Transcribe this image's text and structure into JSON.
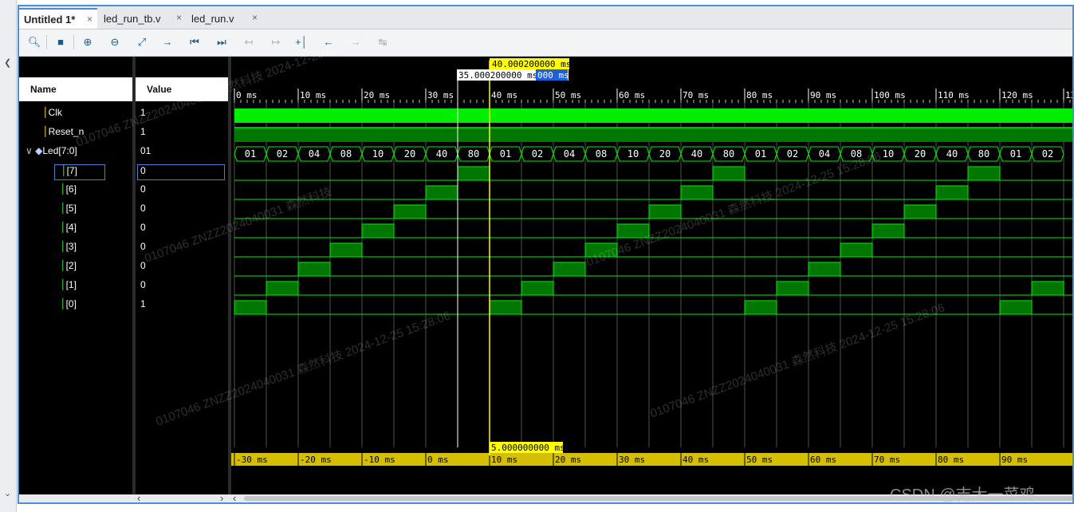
{
  "tabs": [
    {
      "label": "Untitled 1*",
      "active": true
    },
    {
      "label": "led_run_tb.v",
      "active": false
    },
    {
      "label": "led_run.v",
      "active": false
    }
  ],
  "tab_close_glyph": "×",
  "toolbar_icons": [
    "search-icon",
    "save-icon",
    "zoom-in-icon",
    "zoom-out-icon",
    "zoom-fit-icon",
    "go-to-cursor-icon",
    "go-to-time-0-icon",
    "go-to-last-time-icon",
    "previous-transition-icon",
    "next-transition-icon",
    "add-marker-icon",
    "previous-marker-icon",
    "next-marker-icon",
    "swap-cursors-icon"
  ],
  "columns": {
    "name": "Name",
    "value": "Value"
  },
  "signals": [
    {
      "name": "Clk",
      "value": "1",
      "type": "bit"
    },
    {
      "name": "Reset_n",
      "value": "1",
      "type": "bit"
    },
    {
      "name": "Led[7:0]",
      "value": "01",
      "type": "bus",
      "expanded": true
    },
    {
      "name": "[7]",
      "value": "0",
      "type": "bit",
      "selected": true
    },
    {
      "name": "[6]",
      "value": "0",
      "type": "bit"
    },
    {
      "name": "[5]",
      "value": "0",
      "type": "bit"
    },
    {
      "name": "[4]",
      "value": "0",
      "type": "bit"
    },
    {
      "name": "[3]",
      "value": "0",
      "type": "bit"
    },
    {
      "name": "[2]",
      "value": "0",
      "type": "bit"
    },
    {
      "name": "[1]",
      "value": "0",
      "type": "bit"
    },
    {
      "name": "[0]",
      "value": "1",
      "type": "bit"
    }
  ],
  "cursor": {
    "main": "40.000200000 ms",
    "secondary": "35.000200000 ms",
    "secondary_hidden": "000 ms",
    "delta": "5.000000000 ms"
  },
  "top_ruler": {
    "labels": [
      "0 ms",
      "10 ms",
      "20 ms",
      "30 ms",
      "40 ms",
      "50 ms",
      "60 ms",
      "70 ms",
      "80 ms",
      "90 ms",
      "100 ms",
      "110 ms",
      "120 ms",
      "130"
    ]
  },
  "bottom_ruler": {
    "labels": [
      "-30 ms",
      "-20 ms",
      "-10 ms",
      "0 ms",
      "10 ms",
      "20 ms",
      "30 ms",
      "40 ms",
      "50 ms",
      "60 ms",
      "70 ms",
      "80 ms",
      "90 ms"
    ]
  },
  "bus_values": [
    "01",
    "02",
    "04",
    "08",
    "10",
    "20",
    "40",
    "80",
    "01",
    "02",
    "04",
    "08",
    "10",
    "20",
    "40",
    "80",
    "01",
    "02",
    "04",
    "08",
    "10",
    "20",
    "40",
    "80",
    "01",
    "02"
  ],
  "watermark": "CSDN @吉大一菜鸡",
  "colors": {
    "wave_high": "#00ee00",
    "wave_fill": "#007700",
    "cursor": "#ffff00",
    "marker": "#ffffff",
    "selection": "#4a7fd0"
  }
}
